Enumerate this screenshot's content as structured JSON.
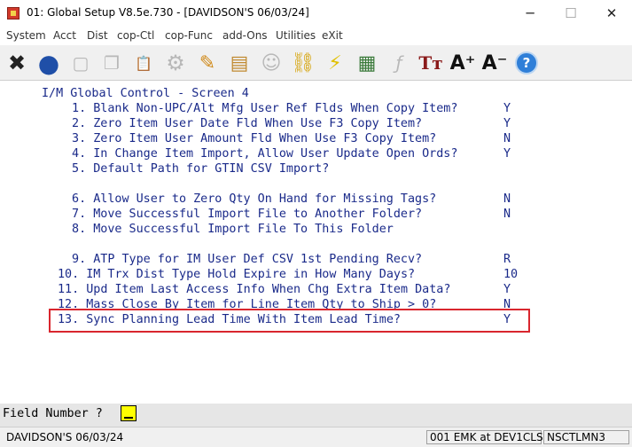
{
  "window": {
    "title": "01: Global Setup V8.5e.730 - [DAVIDSON'S 06/03/24]",
    "controls": {
      "minimize": "─",
      "maximize": "☐",
      "close": "✕"
    }
  },
  "menu": [
    "System",
    "Acct",
    "Dist",
    "cop-Ctl",
    "cop-Func",
    "add-Ons",
    "Utilities",
    "eXit"
  ],
  "toolbar": [
    {
      "icon": "close-x-icon",
      "glyph": "✖",
      "color": "#222222"
    },
    {
      "icon": "globe-icon",
      "glyph": "●",
      "color": "#1f4fa8"
    },
    {
      "icon": "blank-page-icon",
      "glyph": "▢"
    },
    {
      "icon": "copy-icon",
      "glyph": "❐"
    },
    {
      "icon": "paste-icon",
      "glyph": "📋"
    },
    {
      "icon": "settings-gear-icon",
      "glyph": "⚙"
    },
    {
      "icon": "edit-pencil-icon",
      "glyph": "✎",
      "color": "#d08a1a"
    },
    {
      "icon": "notes-icon",
      "glyph": "▤",
      "color": "#c08a30"
    },
    {
      "icon": "users-icon",
      "glyph": "☺"
    },
    {
      "icon": "chain-link-icon",
      "glyph": "⛓",
      "color": "#d4a000"
    },
    {
      "icon": "lightning-icon",
      "glyph": "⚡",
      "color": "#e0c000"
    },
    {
      "icon": "calculator-icon",
      "glyph": "▦",
      "color": "#3a7a3a"
    },
    {
      "icon": "function-icon",
      "glyph": "ƒ"
    },
    {
      "icon": "font-style-icon",
      "glyph": "Tт",
      "color": "#8a1a1a"
    },
    {
      "icon": "font-increase-icon",
      "glyph": "A⁺",
      "color": "#111111"
    },
    {
      "icon": "font-decrease-icon",
      "glyph": "A⁻",
      "color": "#111111"
    },
    {
      "icon": "help-icon",
      "glyph": "?",
      "color": "#ffffff"
    }
  ],
  "screen": {
    "heading": "I/M Global Control - Screen 4",
    "items": [
      {
        "label": " 1. Blank Non-UPC/Alt Mfg User Ref Flds When Copy Item?",
        "value": "Y"
      },
      {
        "label": " 2. Zero Item User Date Fld When Use F3 Copy Item?",
        "value": "Y"
      },
      {
        "label": " 3. Zero Item User Amount Fld When Use F3 Copy Item?",
        "value": "N"
      },
      {
        "label": " 4. In Change Item Import, Allow User Update Open Ords?",
        "value": "Y"
      },
      {
        "label": " 5. Default Path for GTIN CSV Import?",
        "value": ""
      },
      {
        "label": " 6. Allow User to Zero Qty On Hand for Missing Tags?",
        "value": "N"
      },
      {
        "label": " 7. Move Successful Import File to Another Folder?",
        "value": "N"
      },
      {
        "label": " 8. Move Successful Import File To This Folder",
        "value": ""
      },
      {
        "label": " 9. ATP Type for IM User Def CSV 1st Pending Recv?",
        "value": "R"
      },
      {
        "label": "10. IM Trx Dist Type Hold Expire in How Many Days?",
        "value": "10"
      },
      {
        "label": "11. Upd Item Last Access Info When Chg Extra Item Data?",
        "value": "Y"
      },
      {
        "label": "12. Mass Close By Item for Line Item Qty to Ship > 0?",
        "value": "N"
      },
      {
        "label": "13. Sync Planning Lead Time With Item Lead Time?",
        "value": "Y"
      }
    ]
  },
  "prompt": {
    "label": "Field Number ?",
    "value": ""
  },
  "status": {
    "company": "DAVIDSON'S 06/03/24",
    "session": "001 EMK at DEV1CLS",
    "terminal": "NSCTLMN3"
  }
}
